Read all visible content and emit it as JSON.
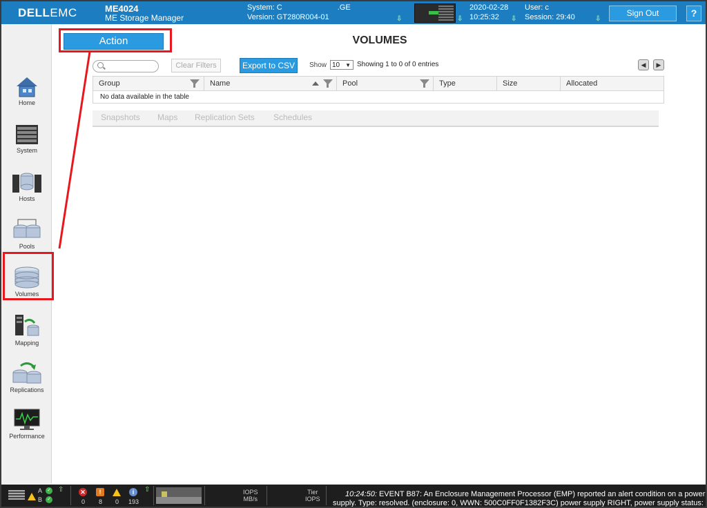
{
  "header": {
    "logo_bold": "DELL",
    "logo_thin": "EMC",
    "model": "ME4024",
    "product": "ME Storage Manager",
    "system_label": "System: C",
    "system_suffix": ".GE",
    "version_label": "Version: GT280R004-01",
    "date": "2020-02-28",
    "time": "10:25:32",
    "user": "User: c",
    "session": "Session: 29:40",
    "sign_out": "Sign Out",
    "help": "?"
  },
  "sidebar": {
    "items": [
      {
        "label": "Home",
        "icon": "home-icon"
      },
      {
        "label": "System",
        "icon": "system-icon"
      },
      {
        "label": "Hosts",
        "icon": "hosts-icon"
      },
      {
        "label": "Pools",
        "icon": "pools-icon"
      },
      {
        "label": "Volumes",
        "icon": "volumes-icon",
        "selected": true
      },
      {
        "label": "Mapping",
        "icon": "mapping-icon"
      },
      {
        "label": "Replications",
        "icon": "replications-icon"
      },
      {
        "label": "Performance",
        "icon": "performance-icon"
      }
    ]
  },
  "main": {
    "action_label": "Action",
    "title": "VOLUMES",
    "search_placeholder": "",
    "clear_filters": "Clear Filters",
    "export_csv": "Export to CSV",
    "show_label": "Show",
    "show_value": "10",
    "entries_text": "Showing 1 to 0 of 0 entries",
    "columns": [
      "Group",
      "Name",
      "Pool",
      "Type",
      "Size",
      "Allocated"
    ],
    "empty_message": "No data available in the table",
    "subtabs": [
      "Snapshots",
      "Maps",
      "Replication Sets",
      "Schedules"
    ]
  },
  "statusbar": {
    "controller_a": "A",
    "controller_b": "B",
    "counts": {
      "critical": "0",
      "error": "8",
      "warning": "0",
      "info": "193"
    },
    "iops_label": "IOPS",
    "mbs_label": "MB/s",
    "tier_label": "Tier",
    "tier_iops_label": "IOPS",
    "event_time": "10:24:50:",
    "event_line1": "EVENT B87: An Enclosure Management Processor (EMP) reported an alert condition on a power",
    "event_line2": "supply. Type: resolved. (enclosure: 0, WWN: 500C0FF0F1382F3C) power supply RIGHT, power supply status:"
  },
  "colors": {
    "header_bg": "#1c7ec0",
    "button_blue": "#2a9be0",
    "highlight_red": "#e8171d"
  }
}
